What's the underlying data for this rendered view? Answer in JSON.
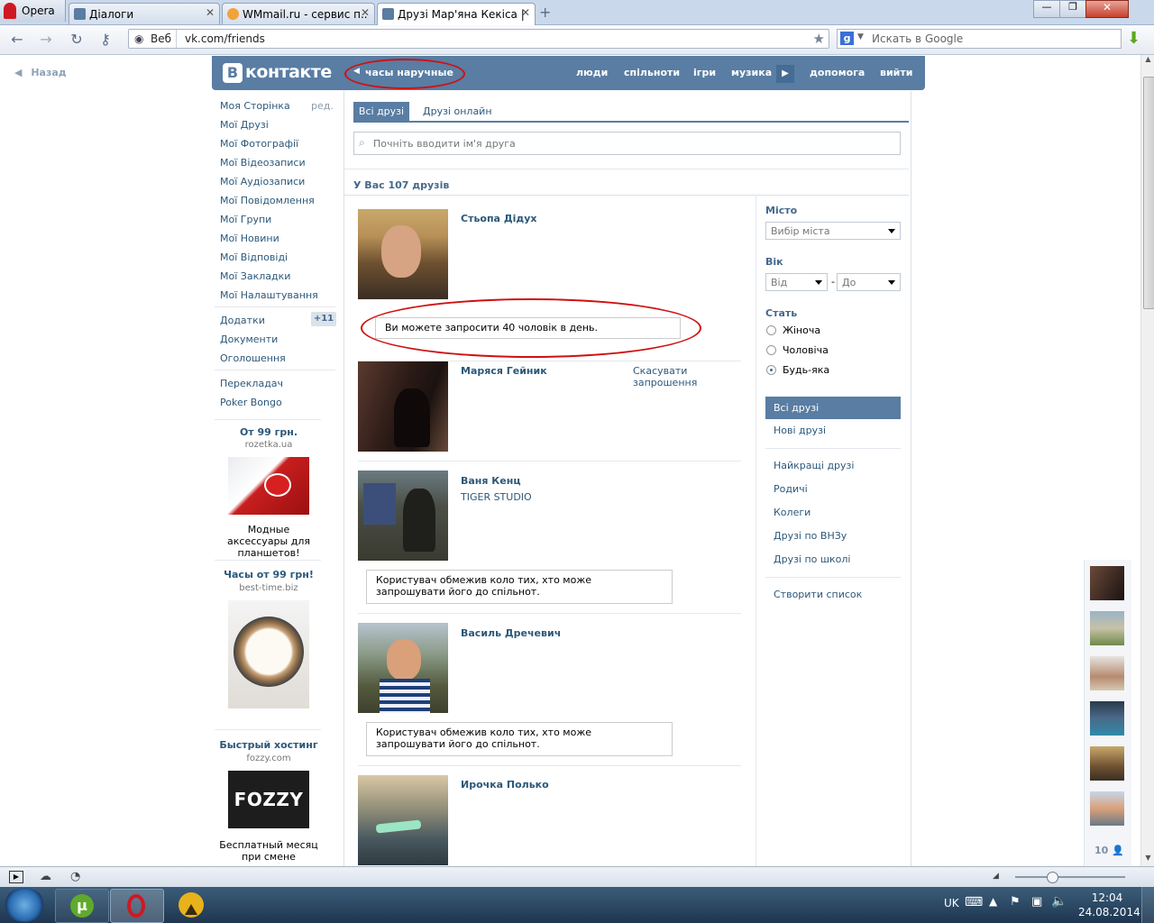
{
  "browser": {
    "menu_label": "Opera",
    "tabs": [
      {
        "title": "Діалоги",
        "active": false
      },
      {
        "title": "WMmail.ru - сервис п...",
        "active": false
      },
      {
        "title": "Друзі Мар'яна Кекіса |...",
        "active": true
      }
    ],
    "web_label": "Веб",
    "url": "vk.com/friends",
    "search_placeholder": "Искать в Google"
  },
  "page": {
    "back_label": "Назад",
    "logo": "контакте",
    "status_text": "часы наручные",
    "nav": [
      "люди",
      "спільноти",
      "ігри",
      "музика",
      "допомога",
      "вийти"
    ],
    "left_menu": [
      {
        "label": "Моя Сторінка",
        "extra": "ред."
      },
      {
        "label": "Мої Друзі"
      },
      {
        "label": "Мої Фотографії"
      },
      {
        "label": "Мої Відеозаписи"
      },
      {
        "label": "Мої Аудіозаписи"
      },
      {
        "label": "Мої Повідомлення"
      },
      {
        "label": "Мої Групи"
      },
      {
        "label": "Мої Новини"
      },
      {
        "label": "Мої Відповіді"
      },
      {
        "label": "Мої Закладки"
      },
      {
        "label": "Мої Налаштування"
      }
    ],
    "left_menu2": [
      {
        "label": "Додатки",
        "badge": "+11"
      },
      {
        "label": "Документи"
      },
      {
        "label": "Оголошення"
      }
    ],
    "left_menu3": [
      "Перекладач",
      "Poker Bongo"
    ],
    "ads": [
      {
        "title": "От 99 грн.",
        "site": "rozetka.ua",
        "text": "Модные аксессуары для планшетов!"
      },
      {
        "title": "Часы от 99 грн!",
        "site": "best-time.biz",
        "text": ""
      },
      {
        "title": "Быстрый хостинг",
        "site": "fozzy.com",
        "logo": "FOZZY",
        "text": "Бесплатный месяц при смене хостинга."
      }
    ],
    "tabs": [
      "Всі друзі",
      "Друзі онлайн"
    ],
    "search_placeholder": "Почніть вводити ім'я друга",
    "friends_count": "У Вас 107 друзів",
    "friends": [
      {
        "name": "Стьопа Дідух",
        "note": "Ви можете запросити 40 чоловік в день."
      },
      {
        "name": "Маряся Гейник",
        "action": "Скасувати запрошення"
      },
      {
        "name": "Ваня Кенц",
        "sub": "TIGER STUDIO",
        "note": "Користувач обмежив коло тих, хто може запрошувати його до спільнот."
      },
      {
        "name": "Василь Дречевич",
        "note": "Користувач обмежив коло тих, хто може запрошувати його до спільнот."
      },
      {
        "name": "Ирочка Полько"
      }
    ],
    "filters": {
      "city_label": "Місто",
      "city_placeholder": "Вибір міста",
      "age_label": "Вік",
      "age_from": "Від",
      "age_to": "До",
      "age_sep": "-",
      "sex_label": "Стать",
      "sex_options": [
        "Жіноча",
        "Чоловіча",
        "Будь-яка"
      ],
      "sex_selected": "Будь-яка"
    },
    "right_menu_active": "Всі друзі",
    "right_menu": [
      "Нові друзі",
      "Найкращі друзі",
      "Родичі",
      "Колеги",
      "Друзі по ВНЗу",
      "Друзі по школі",
      "Створити список"
    ],
    "online_count": "10"
  },
  "taskbar": {
    "lang": "UK",
    "time": "12:04",
    "date": "24.08.2014"
  },
  "colors": {
    "vk_blue": "#597da3",
    "link": "#2b587a",
    "annotation_red": "#d01010"
  }
}
